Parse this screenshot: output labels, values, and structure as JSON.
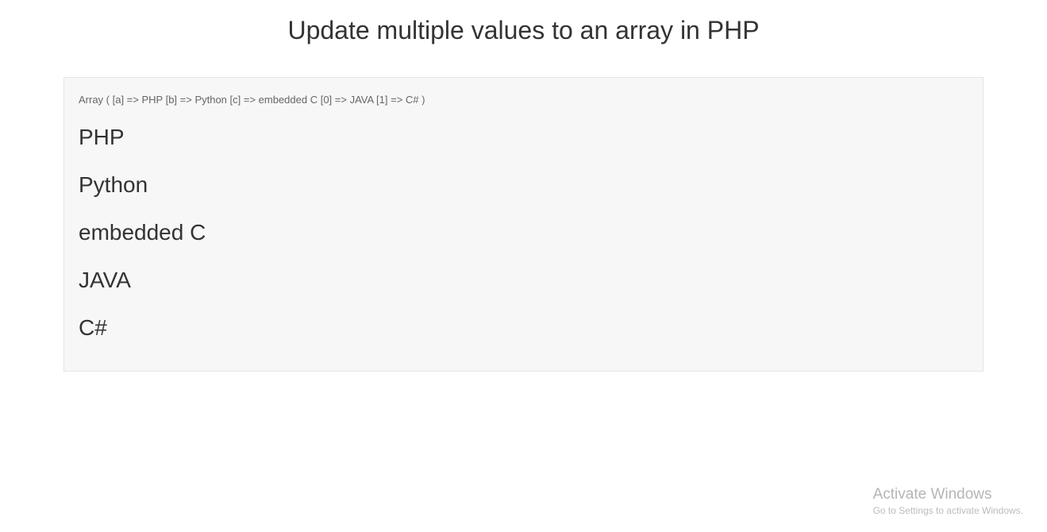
{
  "title": "Update multiple values to an array in PHP",
  "array_dump": "Array ( [a] => PHP [b] => Python [c] => embedded C [0] => JAVA [1] => C# )",
  "items": [
    "PHP",
    "Python",
    "embedded C",
    "JAVA",
    "C#"
  ],
  "watermark": {
    "title": "Activate Windows",
    "subtitle": "Go to Settings to activate Windows."
  }
}
